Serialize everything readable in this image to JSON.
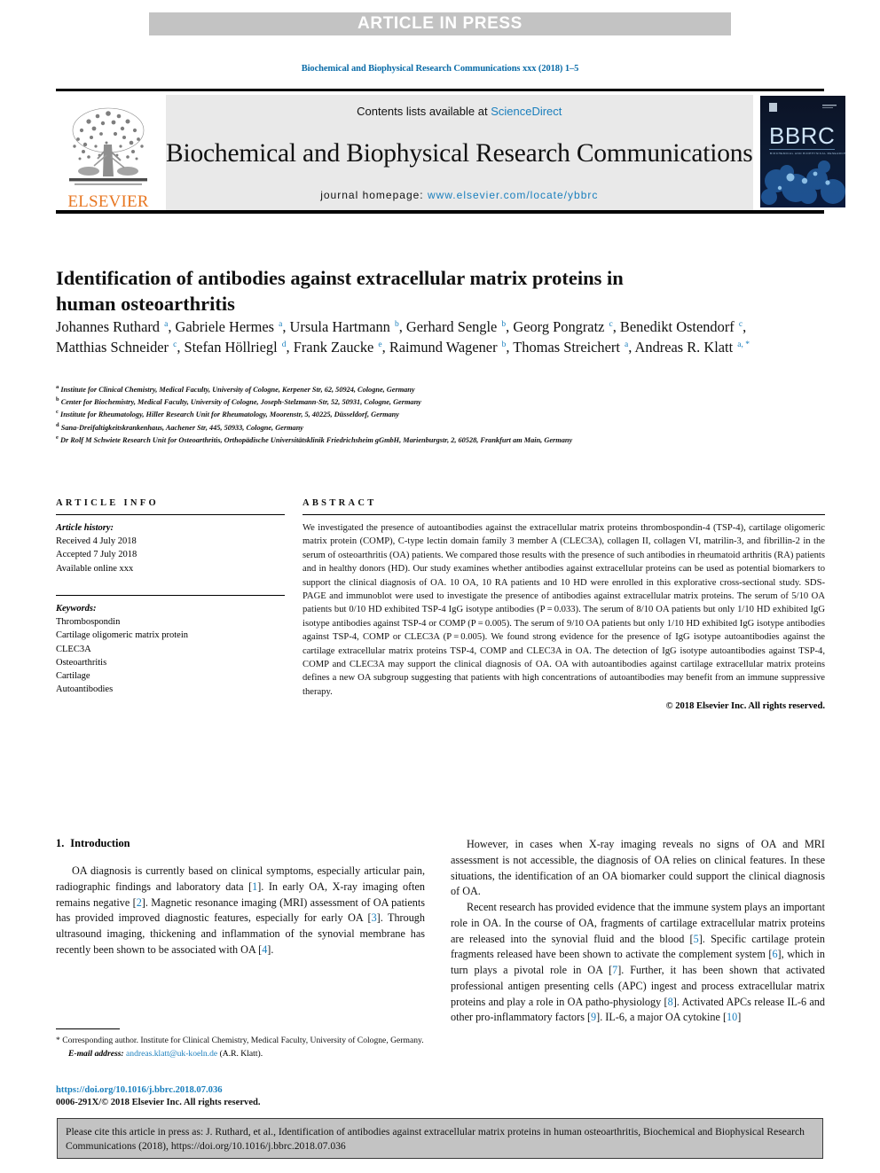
{
  "banner": {
    "label": "ARTICLE IN PRESS"
  },
  "running_head": "Biochemical and Biophysical Research Communications xxx (2018) 1–5",
  "masthead": {
    "contents_prefix": "Contents lists available at ",
    "contents_link": "ScienceDirect",
    "journal_name": "Biochemical and Biophysical Research Communications",
    "homepage_prefix": "journal homepage: ",
    "homepage_url": "www.elsevier.com/locate/ybbrc",
    "publisher": "ELSEVIER",
    "cover_title": "BBRC"
  },
  "article": {
    "title": "Identification of antibodies against extracellular matrix proteins in human osteoarthritis",
    "authors": [
      {
        "name": "Johannes Ruthard",
        "sup": "a",
        "sep": ", "
      },
      {
        "name": "Gabriele Hermes",
        "sup": "a",
        "sep": ", "
      },
      {
        "name": "Ursula Hartmann",
        "sup": "b",
        "sep": ", "
      },
      {
        "name": "Gerhard Sengle",
        "sup": "b",
        "sep": ", "
      },
      {
        "name": "Georg Pongratz",
        "sup": "c",
        "sep": ", "
      },
      {
        "name": "Benedikt Ostendorf",
        "sup": "c",
        "sep": ", "
      },
      {
        "name": "Matthias Schneider",
        "sup": "c",
        "sep": ", "
      },
      {
        "name": "Stefan Höllriegl",
        "sup": "d",
        "sep": ", "
      },
      {
        "name": "Frank Zaucke",
        "sup": "e",
        "sep": ", "
      },
      {
        "name": "Raimund Wagener",
        "sup": "b",
        "sep": ", "
      },
      {
        "name": "Thomas Streichert",
        "sup": "a",
        "sep": ", "
      },
      {
        "name": "Andreas R. Klatt",
        "sup": "a, *",
        "sep": ""
      }
    ],
    "affiliations": [
      {
        "sup": "a",
        "text": "Institute for Clinical Chemistry, Medical Faculty, University of Cologne, Kerpener Str, 62, 50924, Cologne, Germany"
      },
      {
        "sup": "b",
        "text": "Center for Biochemistry, Medical Faculty, University of Cologne, Joseph-Stelzmann-Str, 52, 50931, Cologne, Germany"
      },
      {
        "sup": "c",
        "text": "Institute for Rheumatology, Hiller Research Unit for Rheumatology, Moorenstr, 5, 40225, Düsseldorf, Germany"
      },
      {
        "sup": "d",
        "text": "Sana-Dreifaltigkeitskrankenhaus, Aachener Str, 445, 50933, Cologne, Germany"
      },
      {
        "sup": "e",
        "text": "Dr Rolf M Schwiete Research Unit for Osteoarthritis, Orthopädische Universitätsklinik Friedrichsheim gGmbH, Marienburgstr, 2, 60528, Frankfurt am Main, Germany"
      }
    ]
  },
  "article_info": {
    "heading": "ARTICLE INFO",
    "history_label": "Article history:",
    "history": [
      "Received 4 July 2018",
      "Accepted 7 July 2018",
      "Available online xxx"
    ],
    "keywords_label": "Keywords:",
    "keywords": [
      "Thrombospondin",
      "Cartilage oligomeric matrix protein",
      "CLEC3A",
      "Osteoarthritis",
      "Cartilage",
      "Autoantibodies"
    ]
  },
  "abstract": {
    "heading": "ABSTRACT",
    "body": "We investigated the presence of autoantibodies against the extracellular matrix proteins thrombospondin-4 (TSP-4), cartilage oligomeric matrix protein (COMP), C-type lectin domain family 3 member A (CLEC3A), collagen II, collagen VI, matrilin-3, and fibrillin-2 in the serum of osteoarthritis (OA) patients. We compared those results with the presence of such antibodies in rheumatoid arthritis (RA) patients and in healthy donors (HD). Our study examines whether antibodies against extracellular proteins can be used as potential biomarkers to support the clinical diagnosis of OA. 10 OA, 10 RA patients and 10 HD were enrolled in this explorative cross-sectional study. SDS-PAGE and immunoblot were used to investigate the presence of antibodies against extracellular matrix proteins. The serum of 5/10 OA patients but 0/10 HD exhibited TSP-4 IgG isotype antibodies (P = 0.033). The serum of 8/10 OA patients but only 1/10 HD exhibited IgG isotype antibodies against TSP-4 or COMP (P = 0.005). The serum of 9/10 OA patients but only 1/10 HD exhibited IgG isotype antibodies against TSP-4, COMP or CLEC3A (P = 0.005). We found strong evidence for the presence of IgG isotype autoantibodies against the cartilage extracellular matrix proteins TSP-4, COMP and CLEC3A in OA. The detection of IgG isotype autoantibodies against TSP-4, COMP and CLEC3A may support the clinical diagnosis of OA. OA with autoantibodies against cartilage extracellular matrix proteins defines a new OA subgroup suggesting that patients with high concentrations of autoantibodies may benefit from an immune suppressive therapy.",
    "copyright": "© 2018 Elsevier Inc. All rights reserved."
  },
  "intro": {
    "number": "1.",
    "heading": "Introduction",
    "left_paragraph_1_parts": [
      "OA diagnosis is currently based on clinical symptoms, especially articular pain, radiographic findings and laboratory data [",
      "1",
      "]. In early OA, X-ray imaging often remains negative [",
      "2",
      "]. Magnetic resonance imaging (MRI) assessment of OA patients has provided improved diagnostic features, especially for early OA [",
      "3",
      "]. Through ultrasound imaging, thickening and inflammation of the synovial membrane has recently been shown to be associated with OA [",
      "4",
      "]."
    ],
    "right_paragraph_1": "However, in cases when X-ray imaging reveals no signs of OA and MRI assessment is not accessible, the diagnosis of OA relies on clinical features. In these situations, the identification of an OA biomarker could support the clinical diagnosis of OA.",
    "right_paragraph_2_parts": [
      "Recent research has provided evidence that the immune system plays an important role in OA. In the course of OA, fragments of cartilage extracellular matrix proteins are released into the synovial fluid and the blood [",
      "5",
      "]. Specific cartilage protein fragments released have been shown to activate the complement system [",
      "6",
      "], which in turn plays a pivotal role in OA [",
      "7",
      "]. Further, it has been shown that activated professional antigen presenting cells (APC) ingest and process extracellular matrix proteins and play a role in OA patho-physiology [",
      "8",
      "]. Activated APCs release IL-6 and other pro-inflammatory factors [",
      "9",
      "]. IL-6, a major OA cytokine [",
      "10",
      "]"
    ]
  },
  "footnote": {
    "corresponding": "* Corresponding author. Institute for Clinical Chemistry, Medical Faculty, University of Cologne, Germany.",
    "email_label": "E-mail address:",
    "email": "andreas.klatt@uk-koeln.de",
    "email_owner": "(A.R. Klatt)."
  },
  "doi_block": {
    "doi": "https://doi.org/10.1016/j.bbrc.2018.07.036",
    "issn": "0006-291X/© 2018 Elsevier Inc. All rights reserved."
  },
  "cite_box": {
    "text": "Please cite this article in press as: J. Ruthard, et al., Identification of antibodies against extracellular matrix proteins in human osteoarthritis, Biochemical and Biophysical Research Communications (2018), https://doi.org/10.1016/j.bbrc.2018.07.036"
  },
  "colors": {
    "link": "#1a7fbd",
    "elsevier_orange": "#e87722",
    "banner_grey": "#c3c3c3",
    "masthead_grey": "#e9e9e9"
  }
}
